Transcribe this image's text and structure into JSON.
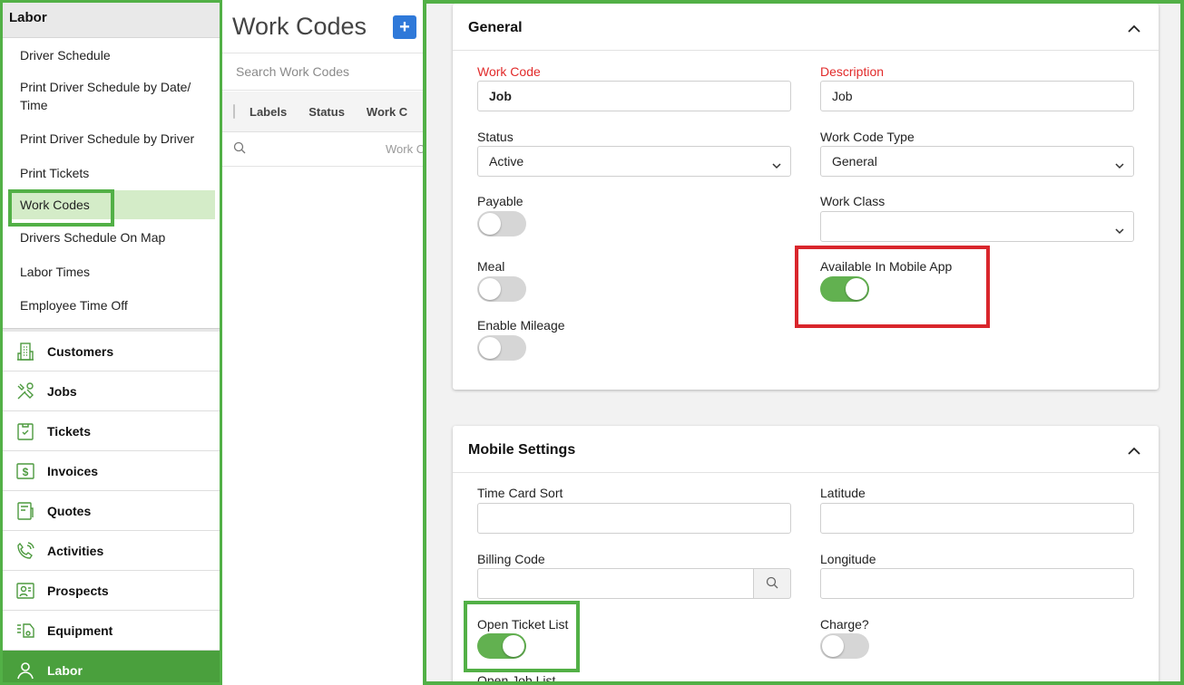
{
  "sidebar": {
    "section_title": "Labor",
    "sub_items": [
      {
        "label": "Driver Schedule"
      },
      {
        "label": "Print Driver Schedule by Date/ Time"
      },
      {
        "label": "Print Driver Schedule by Driver"
      },
      {
        "label": "Print Tickets"
      },
      {
        "label": "Work Codes",
        "active": true
      },
      {
        "label": "Drivers Schedule On Map"
      },
      {
        "label": "Labor Times"
      },
      {
        "label": "Employee Time Off"
      }
    ],
    "nav_items": [
      {
        "label": "Customers",
        "icon": "customers-icon"
      },
      {
        "label": "Jobs",
        "icon": "jobs-icon"
      },
      {
        "label": "Tickets",
        "icon": "tickets-icon"
      },
      {
        "label": "Invoices",
        "icon": "invoices-icon"
      },
      {
        "label": "Quotes",
        "icon": "quotes-icon"
      },
      {
        "label": "Activities",
        "icon": "activities-icon"
      },
      {
        "label": "Prospects",
        "icon": "prospects-icon"
      },
      {
        "label": "Equipment",
        "icon": "equipment-icon"
      },
      {
        "label": "Labor",
        "icon": "labor-icon",
        "active": true
      }
    ]
  },
  "list": {
    "title": "Work Codes",
    "add_label": "+",
    "search_placeholder": "Search Work Codes",
    "columns": [
      "Labels",
      "Status",
      "Work C"
    ],
    "filter_placeholder": "Work C"
  },
  "general": {
    "title": "General",
    "work_code_label": "Work Code",
    "work_code_value": "Job",
    "description_label": "Description",
    "description_value": "Job",
    "status_label": "Status",
    "status_value": "Active",
    "work_code_type_label": "Work Code Type",
    "work_code_type_value": "General",
    "payable_label": "Payable",
    "payable_on": false,
    "work_class_label": "Work Class",
    "work_class_value": "",
    "meal_label": "Meal",
    "meal_on": false,
    "available_mobile_label": "Available In Mobile App",
    "available_mobile_on": true,
    "enable_mileage_label": "Enable Mileage",
    "enable_mileage_on": false
  },
  "mobile": {
    "title": "Mobile Settings",
    "time_card_sort_label": "Time Card Sort",
    "time_card_sort_value": "",
    "latitude_label": "Latitude",
    "latitude_value": "",
    "billing_code_label": "Billing Code",
    "billing_code_value": "",
    "longitude_label": "Longitude",
    "longitude_value": "",
    "open_ticket_list_label": "Open Ticket List",
    "open_ticket_list_on": true,
    "charge_label": "Charge?",
    "charge_on": false,
    "open_job_list_label": "Open Job List"
  },
  "colors": {
    "accent_green": "#4aa03d",
    "toggle_on": "#62b150",
    "required_red": "#e12a2a",
    "highlight_green": "#52b046",
    "highlight_red": "#d9262c",
    "add_button_blue": "#2f79d9"
  }
}
